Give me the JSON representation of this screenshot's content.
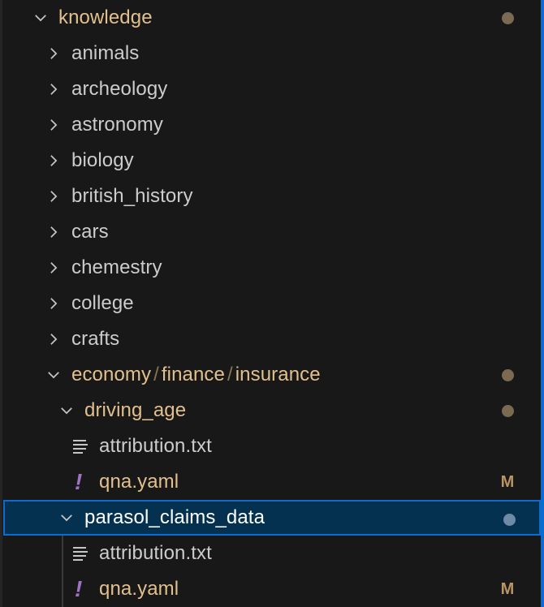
{
  "explorer": {
    "root": {
      "label": "knowledge",
      "expanded": true,
      "status": "dot"
    },
    "folders": [
      {
        "label": "animals"
      },
      {
        "label": "archeology"
      },
      {
        "label": "astronomy"
      },
      {
        "label": "biology"
      },
      {
        "label": "british_history"
      },
      {
        "label": "cars"
      },
      {
        "label": "chemestry"
      },
      {
        "label": "college"
      },
      {
        "label": "crafts"
      }
    ],
    "compact_folder": {
      "segments": [
        "economy",
        "finance",
        "insurance"
      ],
      "separator": "/",
      "expanded": true,
      "status": "dot"
    },
    "driving_age": {
      "label": "driving_age",
      "expanded": true,
      "status": "dot",
      "files": [
        {
          "label": "attribution.txt",
          "icon": "text-file-icon",
          "status": ""
        },
        {
          "label": "qna.yaml",
          "icon": "yaml-exclamation-icon",
          "status": "M"
        }
      ]
    },
    "parasol_claims_data": {
      "label": "parasol_claims_data",
      "expanded": true,
      "selected": true,
      "status": "dot",
      "files": [
        {
          "label": "attribution.txt",
          "icon": "text-file-icon",
          "status": ""
        },
        {
          "label": "qna.yaml",
          "icon": "yaml-exclamation-icon",
          "status": "M"
        }
      ]
    }
  },
  "icons": {
    "yaml_glyph": "!",
    "collapsed": "chevron-right",
    "expanded": "chevron-down"
  },
  "colors": {
    "background": "#181818",
    "modified_text": "#e2c08d",
    "normal_text": "#cccccc",
    "selection_bg": "#04314f",
    "focus_border": "#0a6ccf",
    "yaml_icon": "#a074c4"
  }
}
